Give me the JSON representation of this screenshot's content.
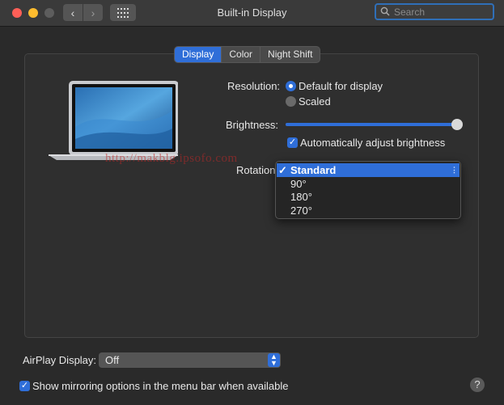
{
  "window": {
    "title": "Built-in Display",
    "search_placeholder": "Search"
  },
  "tabs": [
    {
      "label": "Display",
      "active": true
    },
    {
      "label": "Color",
      "active": false
    },
    {
      "label": "Night Shift",
      "active": false
    }
  ],
  "resolution": {
    "label": "Resolution:",
    "options": [
      {
        "label": "Default for display",
        "selected": true
      },
      {
        "label": "Scaled",
        "selected": false
      }
    ]
  },
  "brightness": {
    "label": "Brightness:",
    "level": 0.99,
    "auto_label": "Automatically adjust brightness",
    "auto_checked": true
  },
  "rotation": {
    "label": "Rotation",
    "options": [
      "Standard",
      "90°",
      "180°",
      "270°"
    ],
    "selected": "Standard"
  },
  "watermark": "http://makblg.ipsofo.com",
  "airplay": {
    "label": "AirPlay Display:",
    "value": "Off"
  },
  "mirroring": {
    "label": "Show mirroring options in the menu bar when available",
    "checked": true
  },
  "colors": {
    "accent": "#2f6ed8",
    "background": "#2a2a2a"
  }
}
